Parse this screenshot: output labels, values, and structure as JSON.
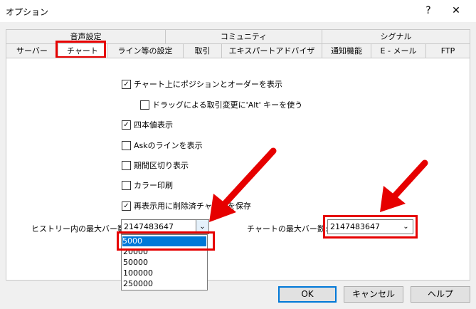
{
  "window": {
    "title": "オプション",
    "help_glyph": "?",
    "close_glyph": "✕"
  },
  "tabs_top": [
    "音声設定",
    "コミュニティ",
    "シグナル"
  ],
  "tabs_bottom": [
    "サーバー",
    "チャート",
    "ライン等の設定",
    "取引",
    "エキスパートアドバイザ",
    "通知機能",
    "E - メール",
    "FTP"
  ],
  "active_tab": "チャート",
  "options": [
    {
      "label": "チャート上にポジションとオーダーを表示",
      "checked": true
    },
    {
      "label": "ドラッグによる取引変更に'Alt' キーを使う",
      "checked": false
    },
    {
      "label": "四本値表示",
      "checked": true
    },
    {
      "label": "Askのラインを表示",
      "checked": false
    },
    {
      "label": "期間区切り表示",
      "checked": false
    },
    {
      "label": "カラー印刷",
      "checked": false
    },
    {
      "label": "再表示用に削除済チャートを保存",
      "checked": true
    }
  ],
  "history_max_bars": {
    "label": "ヒストリー内の最大バー数:",
    "value": "2147483647",
    "dropdown_open": true,
    "options": [
      "5000",
      "20000",
      "50000",
      "100000",
      "250000"
    ],
    "highlighted": "5000"
  },
  "chart_max_bars": {
    "label": "チャートの最大バー数:",
    "value": "2147483647"
  },
  "buttons": {
    "ok": "OK",
    "cancel": "キャンセル",
    "help": "ヘルプ"
  },
  "colors": {
    "annotation_red": "#e60000",
    "highlight_blue": "#0078d7"
  }
}
